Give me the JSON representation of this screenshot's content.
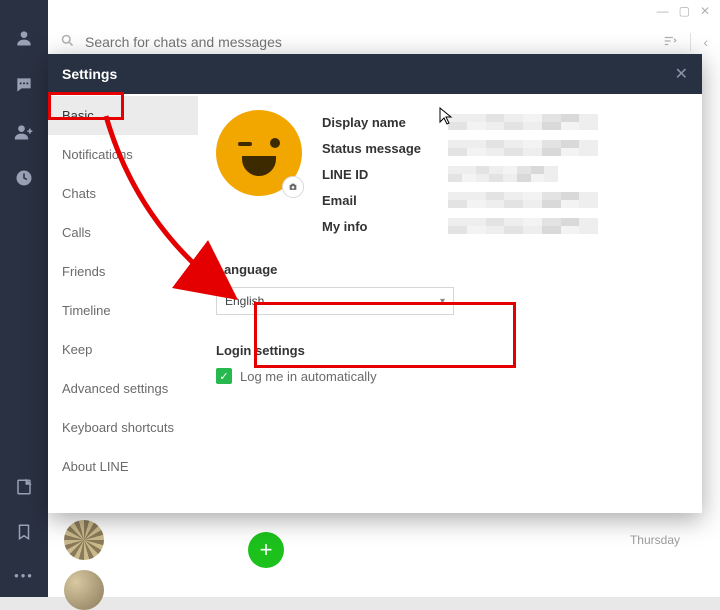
{
  "window": {
    "minimize": "—",
    "maximize": "▢",
    "close": "✕"
  },
  "search": {
    "placeholder": "Search for chats and messages"
  },
  "rail": {
    "icons": [
      "person-icon",
      "chat-icon",
      "add-friend-icon",
      "clock-icon"
    ],
    "bottom_icons": [
      "note-icon",
      "bookmark-icon",
      "more-icon"
    ]
  },
  "chat_preview": {
    "timestamp": "Thursday"
  },
  "modal": {
    "title": "Settings",
    "nav": [
      {
        "label": "Basic",
        "active": true
      },
      {
        "label": "Notifications",
        "active": false
      },
      {
        "label": "Chats",
        "active": false
      },
      {
        "label": "Calls",
        "active": false
      },
      {
        "label": "Friends",
        "active": false
      },
      {
        "label": "Timeline",
        "active": false
      },
      {
        "label": "Keep",
        "active": false
      },
      {
        "label": "Advanced settings",
        "active": false
      },
      {
        "label": "Keyboard shortcuts",
        "active": false
      },
      {
        "label": "About LINE",
        "active": false
      }
    ],
    "profile": {
      "display_name_label": "Display name",
      "status_message_label": "Status message",
      "line_id_label": "LINE ID",
      "email_label": "Email",
      "my_info_label": "My info"
    },
    "language": {
      "section": "Language",
      "selected": "English"
    },
    "login": {
      "section": "Login settings",
      "auto_label": "Log me in automatically",
      "auto_checked": true
    }
  },
  "fab": {
    "glyph": "+"
  },
  "colors": {
    "header": "#283142",
    "annotation": "#e40000",
    "accent_green": "#27b84f",
    "avatar": "#f2a600"
  }
}
